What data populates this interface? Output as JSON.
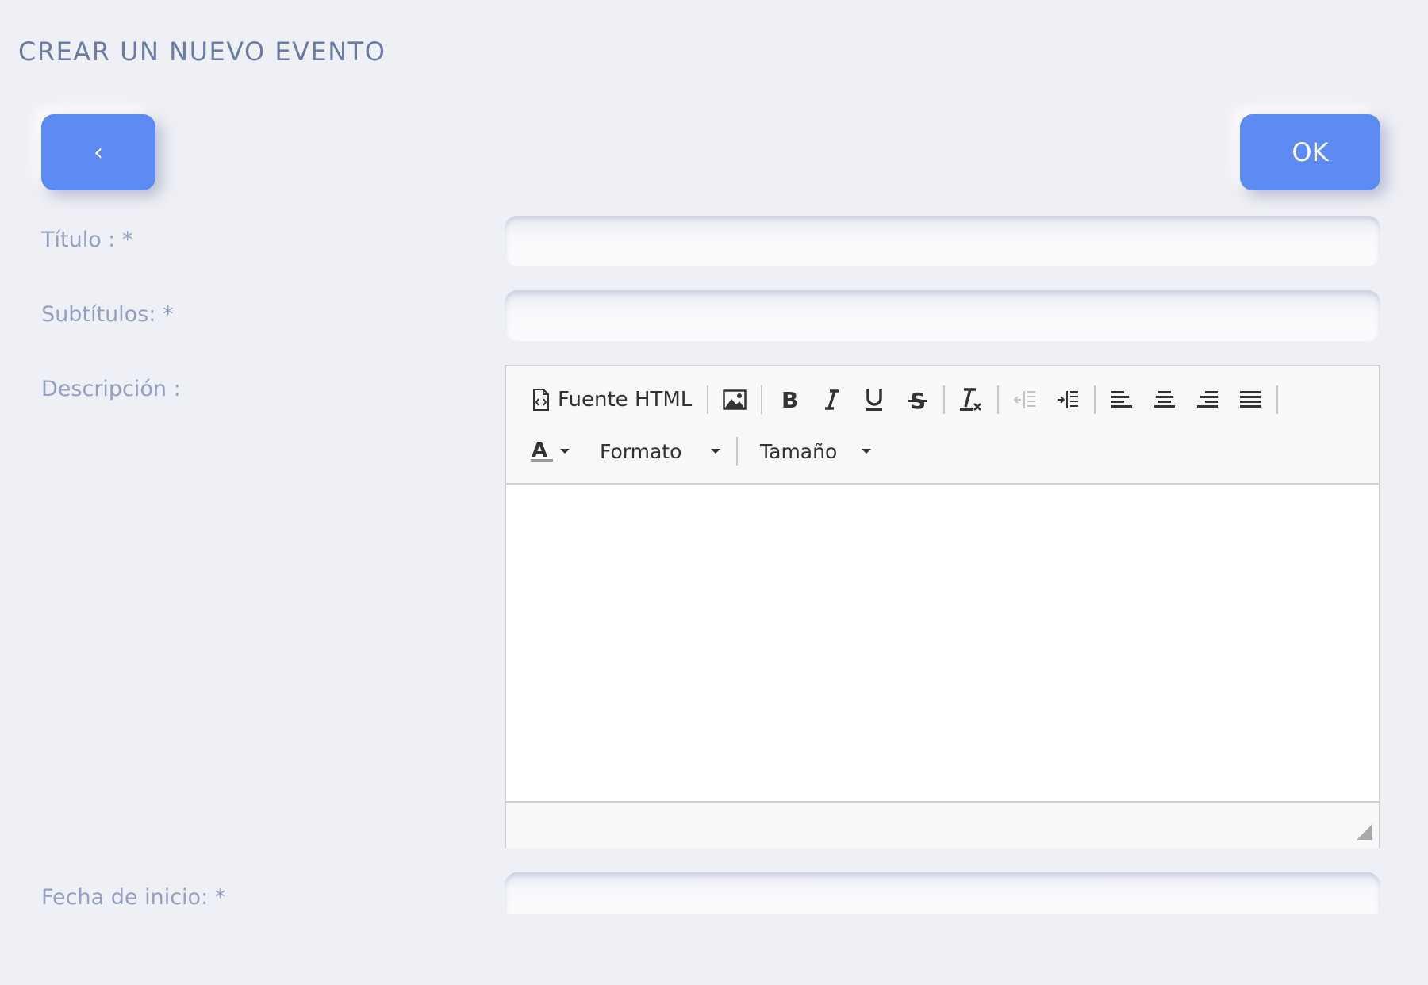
{
  "page": {
    "title": "CREAR UN NUEVO EVENTO"
  },
  "actions": {
    "back_label": "‹",
    "ok_label": "OK"
  },
  "form": {
    "title_label": "Título : *",
    "title_value": "",
    "subtitle_label": "Subtítulos: *",
    "subtitle_value": "",
    "description_label": "Descripción :",
    "start_date_label": "Fecha de inicio: *",
    "start_date_value": ""
  },
  "editor": {
    "toolbar": {
      "source_label": "Fuente HTML",
      "format_label": "Formato",
      "size_label": "Tamaño",
      "icons": [
        "source-icon",
        "image-icon",
        "bold-icon",
        "italic-icon",
        "underline-icon",
        "strikethrough-icon",
        "remove-format-icon",
        "outdent-icon",
        "indent-icon",
        "align-left-icon",
        "align-center-icon",
        "align-right-icon",
        "align-justify-icon",
        "text-color-icon"
      ]
    },
    "content": ""
  },
  "colors": {
    "background": "#eff0f5",
    "accent": "#5e8bf2",
    "title_text": "#6b7ba3",
    "label_text": "#93a0c3",
    "toolbar_bg": "#f8f8f8",
    "border": "#d1d1d1"
  }
}
